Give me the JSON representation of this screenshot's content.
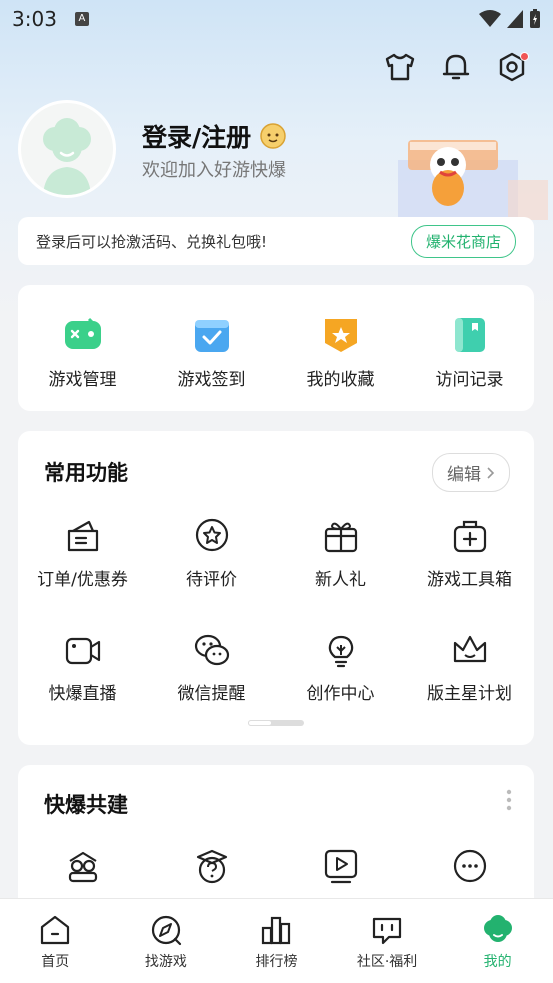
{
  "status_bar": {
    "time": "3:03",
    "a_badge": "A"
  },
  "profile": {
    "title": "登录/注册",
    "subtitle": "欢迎加入好游快爆"
  },
  "banner": {
    "text": "登录后可以抢激活码、兑换礼包哦!",
    "shop_button": "爆米花商店"
  },
  "quick_actions": [
    {
      "label": "游戏管理",
      "icon": "gamepad-icon"
    },
    {
      "label": "游戏签到",
      "icon": "calendar-check-icon"
    },
    {
      "label": "我的收藏",
      "icon": "star-badge-icon"
    },
    {
      "label": "访问记录",
      "icon": "book-icon"
    }
  ],
  "common_functions": {
    "title": "常用功能",
    "edit_label": "编辑",
    "items": [
      {
        "label": "订单/优惠券",
        "icon": "coupon-icon"
      },
      {
        "label": "待评价",
        "icon": "review-star-icon"
      },
      {
        "label": "新人礼",
        "icon": "gift-icon"
      },
      {
        "label": "游戏工具箱",
        "icon": "toolbox-icon"
      },
      {
        "label": "快爆直播",
        "icon": "video-camera-icon"
      },
      {
        "label": "微信提醒",
        "icon": "wechat-icon"
      },
      {
        "label": "创作中心",
        "icon": "lightbulb-icon"
      },
      {
        "label": "版主星计划",
        "icon": "crown-icon"
      }
    ]
  },
  "co_build": {
    "title": "快爆共建",
    "items": [
      {
        "icon": "owl-icon"
      },
      {
        "icon": "question-icon"
      },
      {
        "icon": "play-video-icon"
      },
      {
        "icon": "more-icon"
      }
    ]
  },
  "tabs": [
    {
      "label": "首页",
      "icon": "home-icon"
    },
    {
      "label": "找游戏",
      "icon": "compass-icon"
    },
    {
      "label": "排行榜",
      "icon": "ranking-icon"
    },
    {
      "label": "社区·福利",
      "icon": "community-icon"
    },
    {
      "label": "我的",
      "icon": "profile-icon",
      "active": true
    }
  ],
  "colors": {
    "accent": "#23b26f",
    "background": "#f2f3f5",
    "badge_red": "#f05454"
  }
}
